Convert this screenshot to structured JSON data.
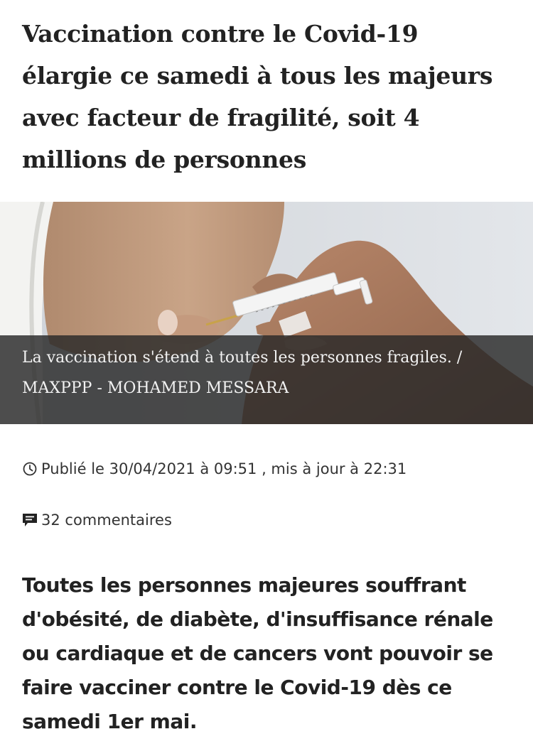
{
  "article": {
    "headline": "Vaccination contre le Covid-19 élargie ce samedi à tous les majeurs avec facteur de fragilité, soit 4 millions de personnes",
    "image": {
      "caption": "La vaccination s'étend à toutes les personnes fragiles.  / MAXPPP - MOHAMED MESSARA"
    },
    "meta": {
      "published": "Publié le 30/04/2021 à 09:51 , mis à jour à 22:31",
      "comments": "32 commentaires"
    },
    "lead": "Toutes les personnes majeures souffrant d'obésité, de diabète, d'insuffisance rénale ou cardiaque et de cancers vont pouvoir se faire vacciner contre le Covid-19 dès ce samedi 1er mai."
  },
  "icons": {
    "published": "clock-icon",
    "comments": "comment-icon"
  },
  "colors": {
    "text": "#222222",
    "caption_overlay": "#282828",
    "caption_text": "#f2f2f2"
  }
}
